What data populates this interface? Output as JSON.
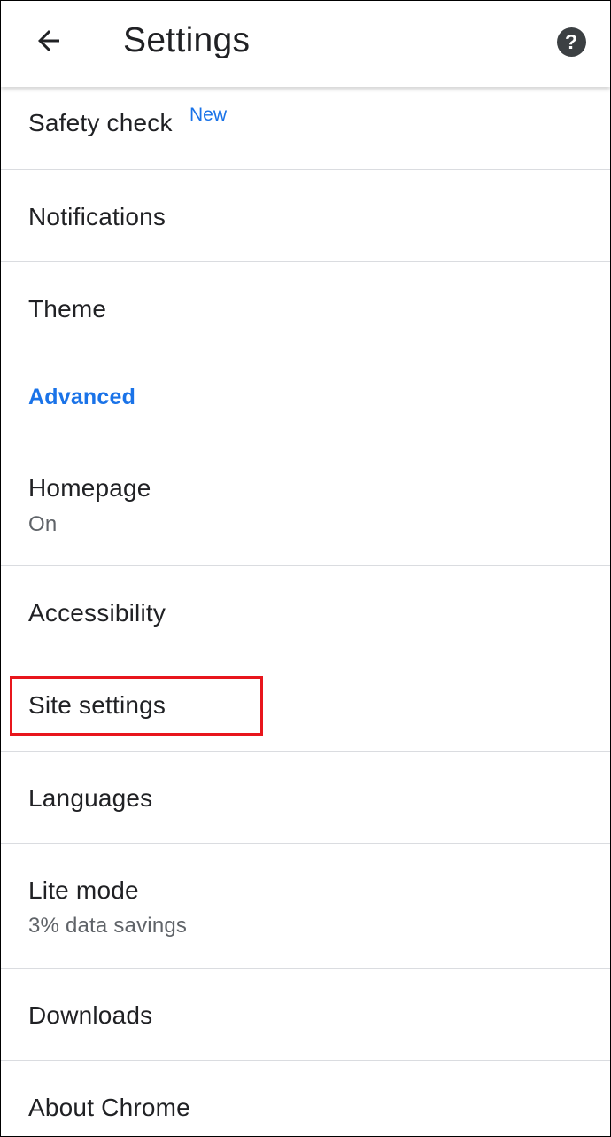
{
  "appbar": {
    "back_icon": "arrow-back-icon",
    "title": "Settings",
    "help_icon": "help-circle-icon",
    "help_glyph": "?"
  },
  "items": [
    {
      "label": "Safety check",
      "badge": "New"
    },
    {
      "label": "Notifications"
    },
    {
      "label": "Theme"
    }
  ],
  "advanced_section": {
    "label": "Advanced"
  },
  "advanced_items": [
    {
      "label": "Homepage",
      "sublabel": "On"
    },
    {
      "label": "Accessibility"
    },
    {
      "label": "Site settings",
      "highlighted": true
    },
    {
      "label": "Languages"
    },
    {
      "label": "Lite mode",
      "sublabel": "3% data savings"
    },
    {
      "label": "Downloads"
    },
    {
      "label": "About Chrome"
    }
  ],
  "colors": {
    "accent": "#1a73e8",
    "highlight": "#e8161c",
    "text_primary": "#202124",
    "text_secondary": "#5f6368",
    "divider": "#dadce0"
  }
}
